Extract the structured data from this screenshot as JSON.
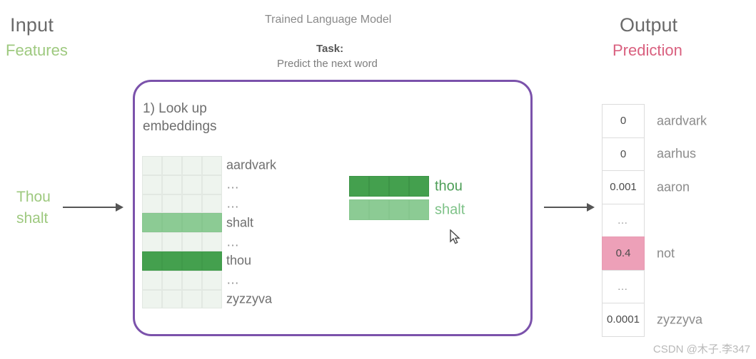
{
  "headers": {
    "input_title": "Input",
    "input_subtitle": "Features",
    "center_title": "Trained Language Model",
    "task_label": "Task:",
    "task_description": "Predict the next word",
    "output_title": "Output",
    "output_subtitle": "Prediction"
  },
  "input": {
    "words": "Thou\nshalt"
  },
  "model": {
    "step_label": "1) Look up\nembeddings",
    "matrix": {
      "columns": 4,
      "rows": [
        {
          "label": "aardvark",
          "shade": "empty"
        },
        {
          "label": "…",
          "shade": "empty"
        },
        {
          "label": "…",
          "shade": "empty"
        },
        {
          "label": "shalt",
          "shade": "light"
        },
        {
          "label": "…",
          "shade": "empty"
        },
        {
          "label": "thou",
          "shade": "dark"
        },
        {
          "label": "…",
          "shade": "empty"
        },
        {
          "label": "zyzzyva",
          "shade": "empty"
        }
      ]
    },
    "embeddings": [
      {
        "label": "thou",
        "shade": "dark",
        "cells": 4
      },
      {
        "label": "shalt",
        "shade": "light",
        "cells": 4
      }
    ]
  },
  "output": {
    "rows": [
      {
        "value": "0",
        "word": "aardvark",
        "highlight": false
      },
      {
        "value": "0",
        "word": "aarhus",
        "highlight": false
      },
      {
        "value": "0.001",
        "word": "aaron",
        "highlight": false
      },
      {
        "value": "…",
        "word": "",
        "highlight": false
      },
      {
        "value": "0.4",
        "word": "not",
        "highlight": true
      },
      {
        "value": "…",
        "word": "",
        "highlight": false
      },
      {
        "value": "0.0001",
        "word": "zyzzyva",
        "highlight": false
      }
    ]
  },
  "watermark": {
    "text": "CSDN @木子.李347"
  },
  "colors": {
    "model_border": "#7b52ab",
    "embedding_dark": "#44a04e",
    "embedding_light": "#8ccb94",
    "embedding_empty": "#eef4ee",
    "prediction_highlight": "#eda0b8",
    "input_accent": "#9ec97f",
    "output_accent": "#d9607f"
  }
}
